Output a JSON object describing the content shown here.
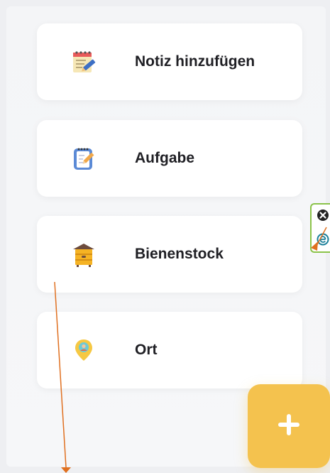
{
  "menu": {
    "items": [
      {
        "label": "Notiz hinzufügen",
        "icon": "note-edit-icon"
      },
      {
        "label": "Aufgabe",
        "icon": "notepad-task-icon"
      },
      {
        "label": "Bienenstock",
        "icon": "beehive-icon"
      },
      {
        "label": "Ort",
        "icon": "location-pin-icon"
      }
    ]
  },
  "fab": {
    "icon": "plus-icon",
    "color": "#f4c24e"
  },
  "colors": {
    "accent": "#f4c24e",
    "arrow": "#e07020",
    "widget_border": "#8bc34a"
  }
}
